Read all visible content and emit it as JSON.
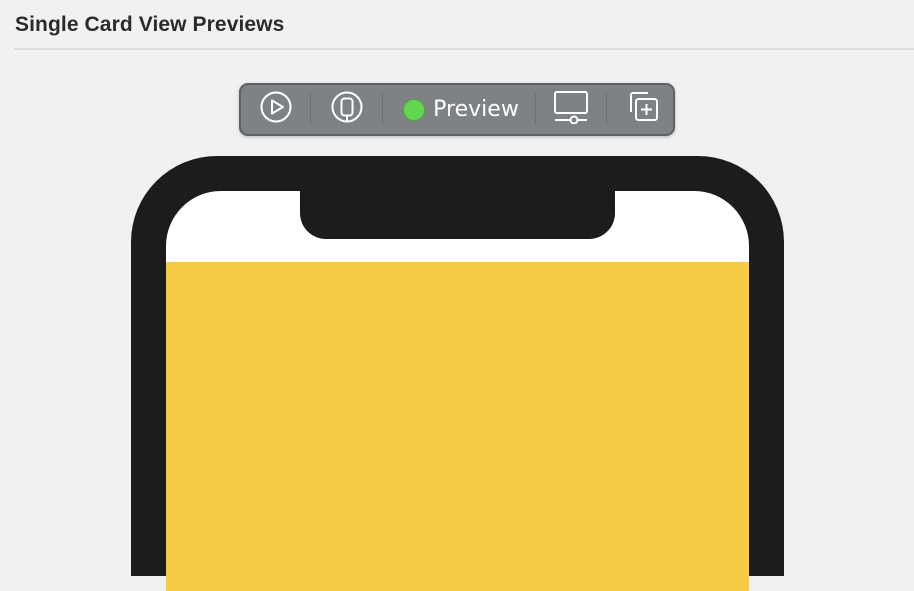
{
  "canvas": {
    "title": "Single Card View Previews"
  },
  "toolbar": {
    "live_icon": "play-circle-icon",
    "selectable_icon": "device-select-icon",
    "preview_label": "Preview",
    "preview_status_color": "#63d64f",
    "device_settings_icon": "device-settings-icon",
    "duplicate_icon": "duplicate-preview-icon"
  },
  "preview": {
    "card_color": "#f7cc45",
    "device_color": "#1c1c1c"
  }
}
